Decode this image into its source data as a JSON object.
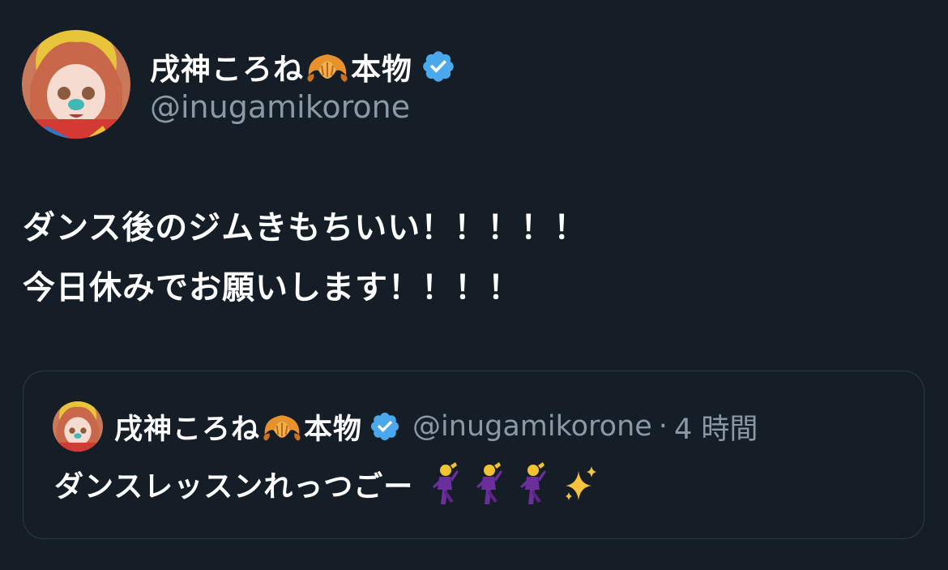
{
  "tweet": {
    "author": {
      "display_name": "戌神ころね",
      "name_emoji": "croissant-icon",
      "name_suffix": "本物",
      "verified": true,
      "handle": "@inugamikorone"
    },
    "lines": [
      "ダンス後のジムきもちいい！！！！！",
      "今日休みでお願いします！！！！"
    ]
  },
  "quoted_tweet": {
    "author": {
      "display_name": "戌神ころね",
      "name_emoji": "croissant-icon",
      "name_suffix": "本物",
      "verified": true,
      "handle": "@inugamikorone"
    },
    "separator": "·",
    "time": "4 時間",
    "text": "ダンスレッスンれっつごー",
    "emojis": [
      "dancer-icon",
      "dancer-icon",
      "dancer-icon",
      "sparkles-icon"
    ]
  },
  "colors": {
    "background": "#151d27",
    "text_primary": "#ffffff",
    "text_secondary": "#8b99a6",
    "verified": "#4aa9ec",
    "border": "#2f3942"
  }
}
